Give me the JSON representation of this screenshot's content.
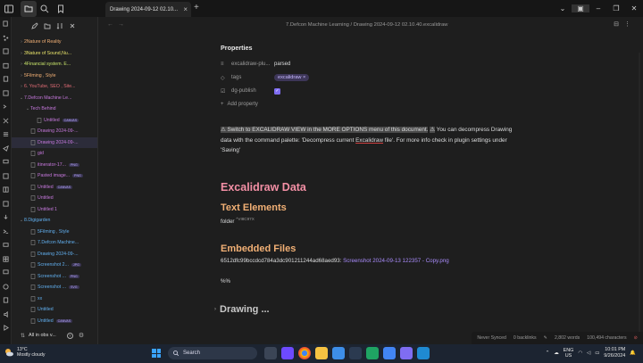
{
  "window": {
    "tab_title": "Drawing 2024-09-12 02.10...",
    "tab_close": "×",
    "new_tab": "+",
    "controls": [
      "⌄",
      "▣",
      "–",
      "❐",
      "✕"
    ]
  },
  "sidebar": {
    "items": [
      {
        "label": "2Nature of Reality",
        "depth": 0,
        "kind": "folder",
        "color": "#f2b075"
      },
      {
        "label": "3Nature of Sound,Nu...",
        "depth": 0,
        "kind": "folder",
        "color": "#e8e36a"
      },
      {
        "label": "4Financial system. E...",
        "depth": 0,
        "kind": "folder",
        "color": "#c7e36a"
      },
      {
        "label": "5Filming , Style",
        "depth": 0,
        "kind": "folder",
        "color": "#f2b075"
      },
      {
        "label": "6. YouTube, SEO , Site...",
        "depth": 0,
        "kind": "folder",
        "color": "#e06c75"
      },
      {
        "label": "7.Defcon Machine Le...",
        "depth": 0,
        "kind": "folder-open",
        "color": "#c678dd"
      },
      {
        "label": "Tech Behind",
        "depth": 1,
        "kind": "folder-open",
        "color": "#c678dd"
      },
      {
        "label": "Untitled",
        "depth": 2,
        "kind": "file",
        "color": "#c678dd",
        "badge": "CANVAS"
      },
      {
        "label": "Drawing 2024-09-...",
        "depth": 1,
        "kind": "file",
        "color": "#c678dd"
      },
      {
        "label": "Drawing 2024-09-...",
        "depth": 1,
        "kind": "file",
        "color": "#c678dd",
        "selected": true
      },
      {
        "label": "gid",
        "depth": 1,
        "kind": "file",
        "color": "#c678dd"
      },
      {
        "label": "itinerator-17...",
        "depth": 1,
        "kind": "file",
        "color": "#c678dd",
        "badge": "PNG"
      },
      {
        "label": "Pasted image...",
        "depth": 1,
        "kind": "file",
        "color": "#c678dd",
        "badge": "PNG"
      },
      {
        "label": "Untitled",
        "depth": 1,
        "kind": "file",
        "color": "#c678dd",
        "badge": "CANVAS"
      },
      {
        "label": "Untitled",
        "depth": 1,
        "kind": "file",
        "color": "#c678dd"
      },
      {
        "label": "Untitled 1",
        "depth": 1,
        "kind": "file",
        "color": "#c678dd"
      },
      {
        "label": "8.Digigarden",
        "depth": 0,
        "kind": "folder-open",
        "color": "#61afef"
      },
      {
        "label": "5Filming , Style",
        "depth": 1,
        "kind": "file",
        "color": "#61afef"
      },
      {
        "label": "7.Defcon Machine...",
        "depth": 1,
        "kind": "file",
        "color": "#61afef"
      },
      {
        "label": "Drawing 2024-09-...",
        "depth": 1,
        "kind": "file",
        "color": "#61afef"
      },
      {
        "label": "Screenshot 2...",
        "depth": 1,
        "kind": "file",
        "color": "#61afef",
        "badge": "JPG"
      },
      {
        "label": "Screenshot ...",
        "depth": 1,
        "kind": "file",
        "color": "#61afef",
        "badge": "PNG"
      },
      {
        "label": "Screenshot ...",
        "depth": 1,
        "kind": "file",
        "color": "#61afef",
        "badge": "SVG"
      },
      {
        "label": "xx",
        "depth": 1,
        "kind": "file",
        "color": "#61afef"
      },
      {
        "label": "Untitled",
        "depth": 1,
        "kind": "file",
        "color": "#61afef"
      },
      {
        "label": "Untitled",
        "depth": 1,
        "kind": "file",
        "color": "#61afef",
        "badge": "CANVAS"
      }
    ],
    "vault_name": "All in obs v...",
    "help_label": "?"
  },
  "nav": {
    "back": "←",
    "forward": "→",
    "breadcrumb": "7.Defcon Machine Learning / Drawing 2024-09-12 02.10.40.excalidraw"
  },
  "properties": {
    "title": "Properties",
    "rows": [
      {
        "key": "excalidraw-plu...",
        "value": "parsed",
        "icon": "≡"
      },
      {
        "key": "tags",
        "value": "excalidraw",
        "icon": "◇"
      },
      {
        "key": "dg-publish",
        "value": "",
        "icon": "☑"
      }
    ],
    "add_label": "Add property"
  },
  "notice": {
    "warn": "⚠",
    "highlight": "Switch to EXCALIDRAW VIEW in the MORE OPTIONS menu of this document.",
    "rest_a": "You can decompress Drawing data with the command palette: 'Decompress current ",
    "rest_word": "Excalidraw",
    "rest_b": " file'. For more info check in plugin settings under 'Saving'"
  },
  "doc": {
    "h1": "Excalidraw Data",
    "h2_text": "Text Elements",
    "folder_text": "folder",
    "folder_ref": "^VI8C97X",
    "h2_embed": "Embedded Files",
    "embed_hash": "6512dfc99bccdcd784a3dc901211244ad68aed93: ",
    "embed_link": "Screenshot 2024-09-13 122357 - Copy.png",
    "percent": "%%",
    "drawing": "Drawing ..."
  },
  "statusbar": {
    "sync": "Never Synced",
    "backlinks": "0 backlinks",
    "words": "2,802 words",
    "chars": "100,494 characters"
  },
  "taskbar": {
    "temp": "13°C",
    "weather": "Mostly cloudy",
    "search_placeholder": "Search",
    "lang1": "ENG",
    "lang2": "US",
    "time": "10:01 PM",
    "date": "9/26/2024"
  },
  "colors": {
    "accent": "#7f6df2",
    "h1": "#f38fa5",
    "h2": "#f2b075"
  }
}
